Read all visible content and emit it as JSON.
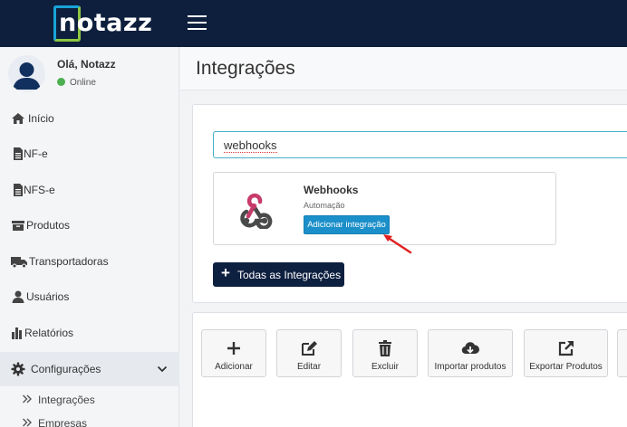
{
  "brand": {
    "logo_text": "notazz"
  },
  "user": {
    "greeting": "Olá, Notazz",
    "status": "Online"
  },
  "sidebar": {
    "items": [
      {
        "label": "Início"
      },
      {
        "label": "NF-e"
      },
      {
        "label": "NFS-e"
      },
      {
        "label": "Produtos"
      },
      {
        "label": "Transportadoras"
      },
      {
        "label": "Usuários"
      },
      {
        "label": "Relatórios"
      },
      {
        "label": "Configurações"
      }
    ],
    "submenu": [
      {
        "label": "Integrações"
      },
      {
        "label": "Empresas"
      }
    ]
  },
  "page": {
    "title": "Integrações"
  },
  "search": {
    "value": "webhooks"
  },
  "result": {
    "name": "Webhooks",
    "category": "Automação",
    "add_button": "Adicionar integração"
  },
  "all_integrations_button": "Todas as Integrações",
  "toolbar": {
    "add": "Adicionar",
    "edit": "Editar",
    "delete": "Excluir",
    "import": "Importar produtos",
    "export": "Exportar Produtos"
  },
  "colors": {
    "topbar": "#0d1f3c",
    "accent_button": "#1b8fc9",
    "primary_button": "#0e2040",
    "online": "#4caf50",
    "webhook_pink": "#c73b6a"
  }
}
